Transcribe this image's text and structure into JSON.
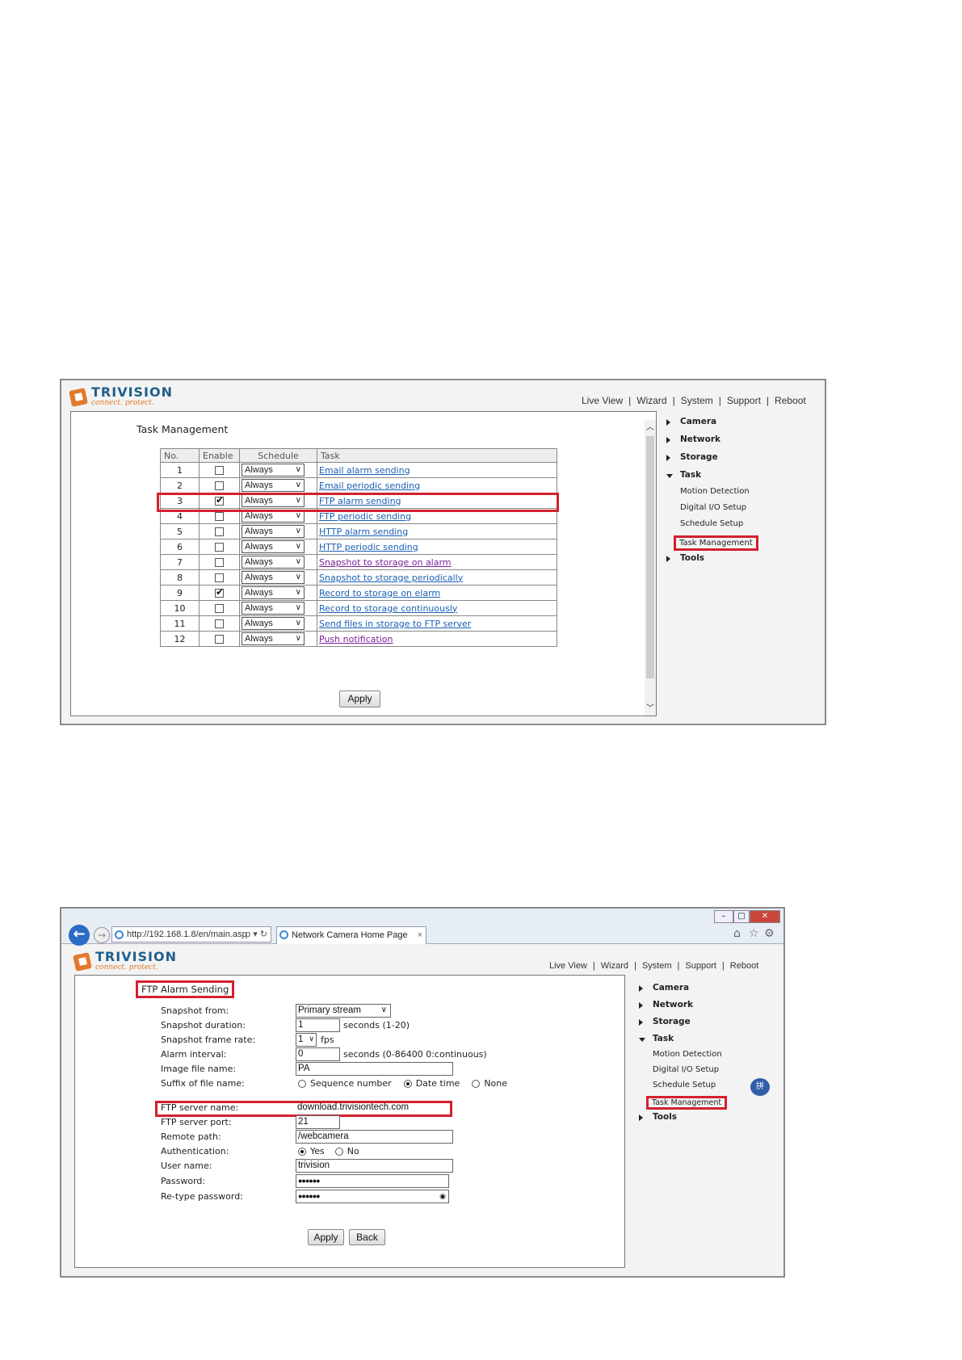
{
  "brand": {
    "name": "TRIVISION",
    "tagline": "connect. protect."
  },
  "topnav": [
    "Live View",
    "Wizard",
    "System",
    "Support",
    "Reboot"
  ],
  "sidemenu": {
    "items": [
      "Camera",
      "Network",
      "Storage",
      "Task"
    ],
    "task_subitems": [
      "Motion Detection",
      "Digital I/O Setup",
      "Schedule Setup",
      "Task Management"
    ],
    "last_item": "Tools"
  },
  "task_management": {
    "title": "Task Management",
    "headers": [
      "No.",
      "Enable",
      "Schedule",
      "Task"
    ],
    "rows": [
      {
        "no": "1",
        "enabled": false,
        "schedule": "Always",
        "task": "Email alarm sending",
        "visited": false
      },
      {
        "no": "2",
        "enabled": false,
        "schedule": "Always",
        "task": "Email periodic sending",
        "visited": false
      },
      {
        "no": "3",
        "enabled": true,
        "schedule": "Always",
        "task": "FTP alarm sending",
        "visited": false,
        "highlight": true
      },
      {
        "no": "4",
        "enabled": false,
        "schedule": "Always",
        "task": "FTP periodic sending",
        "visited": false
      },
      {
        "no": "5",
        "enabled": false,
        "schedule": "Always",
        "task": "HTTP alarm sending",
        "visited": false
      },
      {
        "no": "6",
        "enabled": false,
        "schedule": "Always",
        "task": "HTTP periodic sending",
        "visited": false
      },
      {
        "no": "7",
        "enabled": false,
        "schedule": "Always",
        "task": "Snapshot to storage on alarm",
        "visited": true
      },
      {
        "no": "8",
        "enabled": false,
        "schedule": "Always",
        "task": "Snapshot to storage periodically",
        "visited": false
      },
      {
        "no": "9",
        "enabled": true,
        "schedule": "Always",
        "task": "Record to storage on elarm",
        "visited": false
      },
      {
        "no": "10",
        "enabled": false,
        "schedule": "Always",
        "task": "Record to storage continuously",
        "visited": false
      },
      {
        "no": "11",
        "enabled": false,
        "schedule": "Always",
        "task": "Send files in storage to FTP server",
        "visited": false
      },
      {
        "no": "12",
        "enabled": false,
        "schedule": "Always",
        "task": "Push notification",
        "visited": true
      }
    ],
    "apply_label": "Apply"
  },
  "browser": {
    "url": "http://192.168.1.8/en/main.asp",
    "search_glyphs": "ρ ▾ ↻",
    "tab_title": "Network Camera Home Page",
    "tab_close": "×",
    "win_controls": [
      "–",
      "□",
      "✕"
    ],
    "toolbar_icons": [
      "⌂",
      "☆",
      "⚙"
    ]
  },
  "ftp_form": {
    "title": "FTP Alarm Sending",
    "labels": {
      "snapshot_from": "Snapshot from:",
      "snapshot_duration": "Snapshot duration:",
      "snapshot_frame_rate": "Snapshot frame rate:",
      "alarm_interval": "Alarm interval:",
      "image_file_name": "Image file name:",
      "suffix": "Suffix of file name:",
      "ftp_server_name": "FTP server name:",
      "ftp_server_port": "FTP server port:",
      "remote_path": "Remote path:",
      "authentication": "Authentication:",
      "user_name": "User name:",
      "password": "Password:",
      "retype_password": "Re-type password:"
    },
    "values": {
      "snapshot_from": "Primary stream",
      "snapshot_duration": "1",
      "snapshot_duration_hint": "seconds (1-20)",
      "frame_rate": "1",
      "frame_rate_unit": "fps",
      "alarm_interval": "0",
      "alarm_interval_hint": "seconds (0-86400 0:continuous)",
      "image_file_name": "PA",
      "suffix_options": [
        "Sequence number",
        "Date time",
        "None"
      ],
      "suffix_selected": "Date time",
      "ftp_server_name": "download.trivisiontech.com",
      "ftp_server_port": "21",
      "remote_path": "/webcamera",
      "auth_options": [
        "Yes",
        "No"
      ],
      "auth_selected": "Yes",
      "user_name": "trivision",
      "password": "●●●●●●",
      "retype_password": "●●●●●●"
    },
    "apply_label": "Apply",
    "back_label": "Back"
  },
  "colors": {
    "highlight": "#d4202e",
    "link": "#1a5fb4",
    "visited": "#7a1e9a",
    "brand_blue": "#1f5f8b",
    "brand_orange": "#e27a2b"
  }
}
